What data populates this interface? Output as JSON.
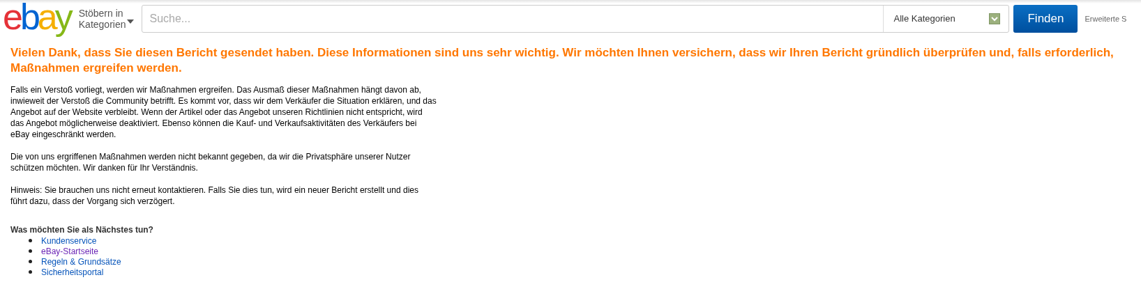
{
  "header": {
    "logo": [
      {
        "text": "e",
        "color": "#e53238"
      },
      {
        "text": "b",
        "color": "#0064d2"
      },
      {
        "text": "a",
        "color": "#f5af02"
      },
      {
        "text": "y",
        "color": "#86b817"
      }
    ],
    "browse": [
      "Stöbern in",
      "Kategorien"
    ],
    "search": {
      "placeholder": "Suche..."
    },
    "category": "Alle Kategorien",
    "find_button": "Finden",
    "advanced_link": "Erweiterte S"
  },
  "heading": "Vielen Dank, dass Sie diesen Bericht gesendet haben. Diese Informationen sind uns sehr wichtig. Wir möchten Ihnen versichern, dass wir Ihren Bericht gründlich überprüfen und, falls erforderlich, Maßnahmen ergreifen werden.",
  "paragraphs": [
    "Falls ein Verstoß vorliegt, werden wir Maßnahmen ergreifen. Das Ausmaß dieser Maßnahmen hängt davon ab, inwieweit der Verstoß die Community betrifft. Es kommt vor, dass wir dem Verkäufer die Situation erklären, und das Angebot auf der Website verbleibt. Wenn der Artikel oder das Angebot unseren Richtlinien nicht entspricht, wird das Angebot möglicherweise deaktiviert. Ebenso können die Kauf- und Verkaufsaktivitäten des Verkäufers bei eBay eingeschränkt werden.",
    "Die von uns ergriffenen Maßnahmen werden nicht bekannt gegeben, da wir die Privatsphäre unserer Nutzer schützen möchten. Wir danken für Ihr Verständnis.",
    "Hinweis: Sie brauchen uns nicht erneut kontaktieren. Falls Sie dies tun, wird ein neuer Bericht erstellt und dies führt dazu, dass der Vorgang sich verzögert."
  ],
  "next_steps": {
    "title": "Was möchten Sie als Nächstes tun?",
    "links": [
      {
        "label": "Kundenservice",
        "visited": false
      },
      {
        "label": "eBay-Startseite",
        "visited": true
      },
      {
        "label": "Regeln & Grundsätze",
        "visited": false
      },
      {
        "label": "Sicherheitsportal",
        "visited": false
      }
    ]
  }
}
